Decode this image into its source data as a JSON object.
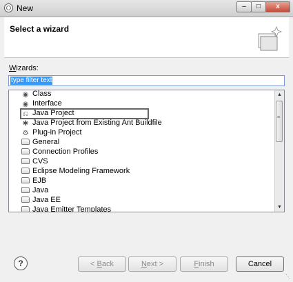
{
  "window": {
    "title": "New",
    "minimize_label": "–",
    "maximize_label": "□",
    "close_label": "x"
  },
  "header": {
    "heading": "Select a wizard"
  },
  "wizards": {
    "label_mnemonic": "W",
    "label_rest": "izards:",
    "filter_placeholder": "type filter text"
  },
  "tree": {
    "items": [
      {
        "label": "Class",
        "icon": "class-icon"
      },
      {
        "label": "Interface",
        "icon": "interface-icon"
      },
      {
        "label": "Java Project",
        "icon": "java-project-icon"
      },
      {
        "label": "Java Project from Existing Ant Buildfile",
        "icon": "ant-project-icon"
      },
      {
        "label": "Plug-in Project",
        "icon": "plugin-project-icon"
      },
      {
        "label": "General",
        "icon": "folder-icon"
      },
      {
        "label": "Connection Profiles",
        "icon": "folder-icon"
      },
      {
        "label": "CVS",
        "icon": "folder-icon"
      },
      {
        "label": "Eclipse Modeling Framework",
        "icon": "folder-icon"
      },
      {
        "label": "EJB",
        "icon": "folder-icon"
      },
      {
        "label": "Java",
        "icon": "folder-icon"
      },
      {
        "label": "Java EE",
        "icon": "folder-icon"
      },
      {
        "label": "Java Emitter Templates",
        "icon": "folder-icon"
      }
    ],
    "highlighted": "Java Project"
  },
  "buttons": {
    "help": "?",
    "back_prefix": "< ",
    "back_mnemonic": "B",
    "back_rest": "ack",
    "next_mnemonic": "N",
    "next_rest": "ext >",
    "finish_mnemonic": "F",
    "finish_rest": "inish",
    "cancel": "Cancel"
  },
  "colors": {
    "selection": "#3399ff",
    "highlight_border": "#666666"
  }
}
